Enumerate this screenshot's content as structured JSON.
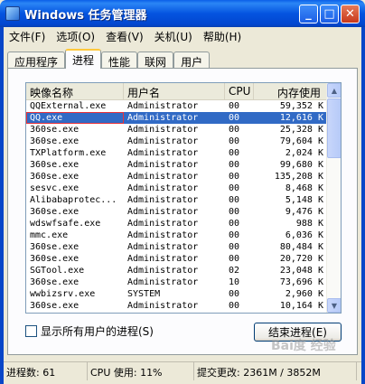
{
  "window": {
    "title": "Windows 任务管理器",
    "minimize": "_",
    "maximize": "□",
    "close": "✕"
  },
  "menu": [
    "文件(F)",
    "选项(O)",
    "查看(V)",
    "关机(U)",
    "帮助(H)"
  ],
  "tabs": [
    "应用程序",
    "进程",
    "性能",
    "联网",
    "用户"
  ],
  "active_tab": "进程",
  "columns": [
    "映像名称",
    "用户名",
    "CPU",
    "内存使用"
  ],
  "processes": [
    [
      "QQExternal.exe",
      "Administrator",
      "00",
      "59,352 K"
    ],
    [
      "QQ.exe",
      "Administrator",
      "00",
      "12,616 K"
    ],
    [
      "360se.exe",
      "Administrator",
      "00",
      "25,328 K"
    ],
    [
      "360se.exe",
      "Administrator",
      "00",
      "79,604 K"
    ],
    [
      "TXPlatform.exe",
      "Administrator",
      "00",
      "2,024 K"
    ],
    [
      "360se.exe",
      "Administrator",
      "00",
      "99,680 K"
    ],
    [
      "360se.exe",
      "Administrator",
      "00",
      "135,208 K"
    ],
    [
      "sesvc.exe",
      "Administrator",
      "00",
      "8,468 K"
    ],
    [
      "Alibabaprotec...",
      "Administrator",
      "00",
      "5,148 K"
    ],
    [
      "360se.exe",
      "Administrator",
      "00",
      "9,476 K"
    ],
    [
      "wdswfsafe.exe",
      "Administrator",
      "00",
      "988 K"
    ],
    [
      "mmc.exe",
      "Administrator",
      "00",
      "6,036 K"
    ],
    [
      "360se.exe",
      "Administrator",
      "00",
      "80,484 K"
    ],
    [
      "360se.exe",
      "Administrator",
      "00",
      "20,720 K"
    ],
    [
      "SGTool.exe",
      "Administrator",
      "02",
      "23,048 K"
    ],
    [
      "360se.exe",
      "Administrator",
      "10",
      "73,696 K"
    ],
    [
      "wwbizsrv.exe",
      "SYSTEM",
      "00",
      "2,960 K"
    ],
    [
      "360se.exe",
      "Administrator",
      "00",
      "10,164 K"
    ]
  ],
  "selected_row": 1,
  "scrollbar": {
    "up": "▲",
    "down": "▼"
  },
  "show_all_users": {
    "label": "显示所有用户的进程(S)",
    "checked": false
  },
  "end_process_button": "结束进程(E)",
  "status": {
    "processes": "进程数: 61",
    "cpu": "CPU 使用: 11%",
    "commit": "提交更改: 2361M / 3852M"
  },
  "watermark": "Bai度 经验"
}
